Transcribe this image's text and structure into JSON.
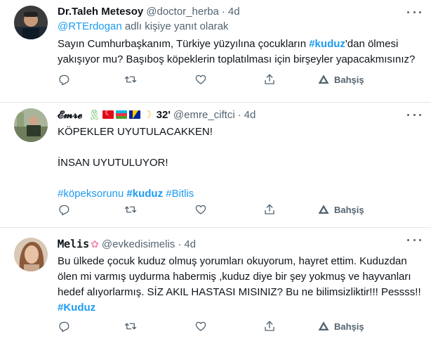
{
  "tweets": [
    {
      "name": "Dr.Taleh Metesoy",
      "handle": "@doctor_herba",
      "dot": "·",
      "time": "4d",
      "replying_handle": "@RTErdogan",
      "replying_suffix": " adlı kişiye yanıt olarak",
      "text_a": "Sayın Cumhurbaşkanım, Türkiye yüzyılına çocukların ",
      "text_hashtag": "#kuduz",
      "text_b": "'dan ölmesi yakışıyor mu? Başıboş köpeklerin toplatılması için birşeyler yapacakmısınız?",
      "promote_label": "Bahşiş"
    },
    {
      "name": "𝓔𝓶𝓻𝓮",
      "name_suffix": "32'",
      "handle": "@emre_ciftci",
      "dot": "·",
      "time": "4d",
      "line1": "KÖPEKLER UYUTULACAKKEN!",
      "line2": "İNSAN UYUTULUYOR!",
      "hashtags": [
        "#köpeksorunu",
        "#kuduz",
        "#Bitlis"
      ],
      "promote_label": "Bahşiş"
    },
    {
      "name": "𝙼𝚎𝚕𝚒𝚜",
      "handle": "@evkedisimelis",
      "dot": "·",
      "time": "4d",
      "text": "Bu ülkede çocuk kuduz olmuş yorumları okuyorum, hayret ettim. Kuduzdan ölen mi varmış uydurma habermiş ,kuduz diye bir şey yokmuş ve hayvanları hedef alıyorlarmış. SİZ AKIL HASTASI MISINIZ? Bu ne bilimsizliktir!!! Pessss!! ",
      "text_hashtag": "#Kuduz",
      "promote_label": "Bahşiş"
    }
  ],
  "icons": {
    "reply": "reply-icon",
    "retweet": "retweet-icon",
    "like": "heart-icon",
    "share": "share-icon",
    "promote": "promote-icon",
    "more": "more-icon"
  },
  "colors": {
    "link": "#1d9bf0",
    "muted": "#536471",
    "text": "#0f1419",
    "divider": "#e3e8ec"
  }
}
